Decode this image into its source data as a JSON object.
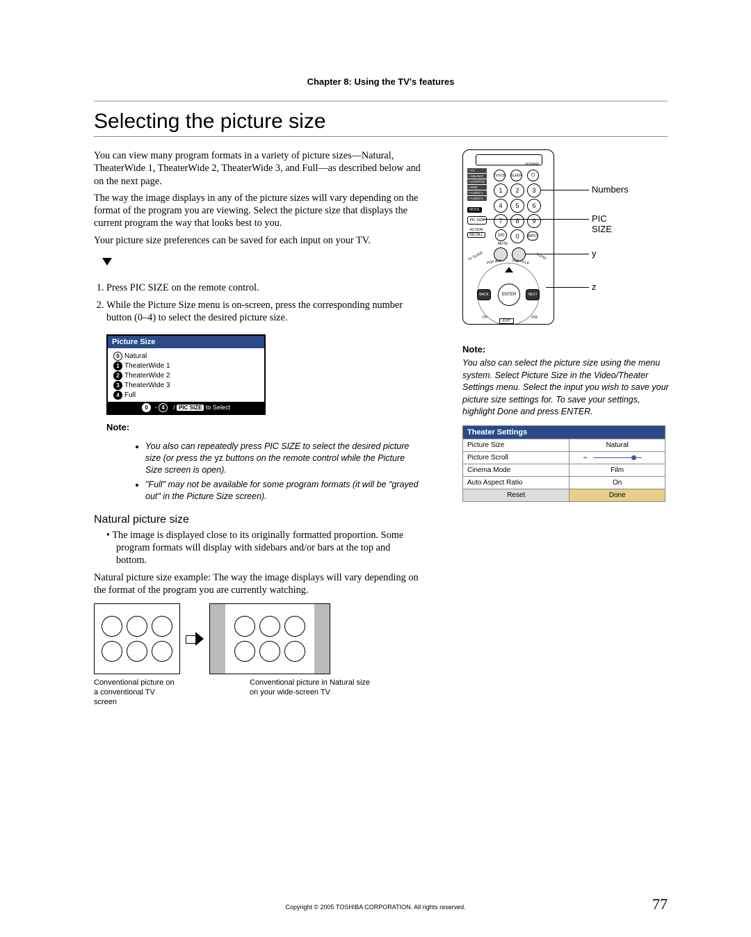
{
  "chapter_header": "Chapter 8: Using the TV's features",
  "page_title": "Selecting the picture size",
  "intro1": "You can view many program formats in a variety of picture sizes—Natural, TheaterWide 1, TheaterWide 2, TheaterWide 3, and Full—as described below and on the next page.",
  "intro2": "The way the image displays in any of the picture sizes will vary depending on the format of the program you are viewing. Select the picture size that displays the current program the way that looks best to you.",
  "intro3": "Your picture size preferences can be saved for each input on your TV.",
  "steps": {
    "s1": "Press PIC SIZE on the remote control.",
    "s2": "While the Picture Size menu is on-screen, press the corresponding number button (0–4) to select the desired picture size."
  },
  "psize_menu": {
    "title": "Picture Size",
    "items": [
      "Natural",
      "TheaterWide 1",
      "TheaterWide 2",
      "TheaterWide 3",
      "Full"
    ],
    "footer_range": "0 - 4",
    "footer_badge": "PIC SIZE",
    "footer_suffix": " to Select"
  },
  "left_note_label": "Note:",
  "left_note_1": "You also can repeatedly press PIC SIZE to select the desired picture size (or press the ",
  "left_note_1b": "yz",
  "left_note_1c": " buttons on the remote control while the Picture Size screen is open).",
  "left_note_2": "\"Full\" may not be available for some program formats (it will be \"grayed out\" in the Picture Size screen).",
  "subhead": "Natural picture size",
  "sub_bullet": "The image is displayed close to its originally formatted proportion. Some program formats will display with sidebars and/or bars at the top and bottom.",
  "example_intro": "Natural picture size example: The way the image displays will vary depending on the format of the program you are currently watching.",
  "caption_left": "Conventional picture on a conventional TV screen",
  "caption_right": "Conventional picture in Natural size on your wide-screen TV",
  "remote": {
    "label_tv": "• TV",
    "label_cbl": "• CBL/SAT",
    "label_dvd": "• VCR/PVR",
    "label_dvd2": "• DVD",
    "label_aud1": "• AUDIO 1",
    "label_aud2": "• AUDIO 2",
    "mode": "MODE",
    "power": "POWER",
    "tvvcr": "TV/VCR",
    "sleep": "SLEEP",
    "picsize": "PIC SIZE",
    "action": "ACTION",
    "recall": "RECALL",
    "input": "INPUT",
    "mute": "MUTE",
    "tvguide": "TV GUIDE",
    "popwin": "POP WIN",
    "subtitle": "SUB TITLE",
    "audio": "AUDIO",
    "enter": "ENTER",
    "back": "BACK",
    "next": "NEXT",
    "ch": "CH",
    "vol": "VOL",
    "exit": "EXIT"
  },
  "callouts": {
    "numbers": "Numbers",
    "picsize": "PIC SIZE",
    "y": "y",
    "z": "z"
  },
  "right_note_label": "Note:",
  "right_note": "You also can select the picture size using the menu system. Select Picture Size in the Video/Theater Settings menu. Select the input you wish to save your picture size settings for. To save your settings, highlight Done and press ENTER.",
  "theater": {
    "title": "Theater Settings",
    "rows": {
      "ps": "Picture Size",
      "ps_v": "Natural",
      "sc": "Picture Scroll",
      "cm": "Cinema Mode",
      "cm_v": "Film",
      "ar": "Auto Aspect Ratio",
      "ar_v": "On",
      "reset": "Reset",
      "done": "Done"
    }
  },
  "footer_copy": "Copyright © 2005 TOSHIBA CORPORATION. All rights reserved.",
  "page_number": "77"
}
